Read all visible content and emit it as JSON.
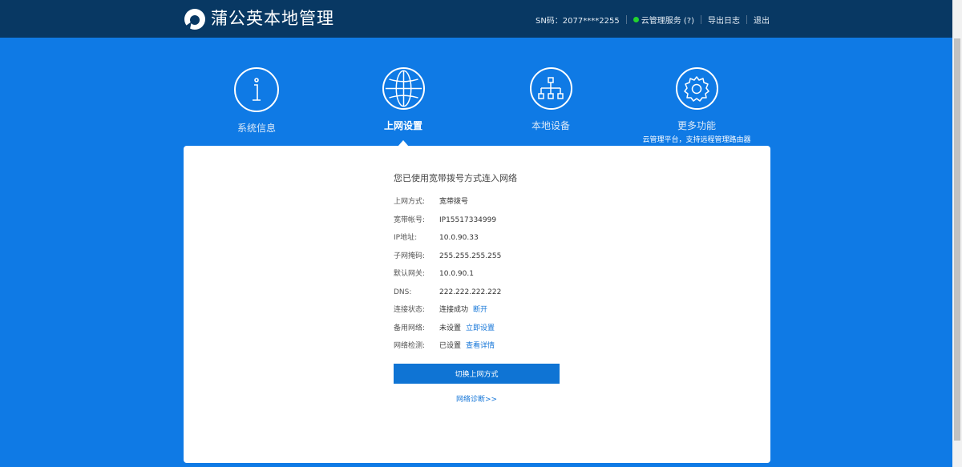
{
  "header": {
    "app_title": "蒲公英本地管理",
    "sn": "SN码：2077****2255",
    "cloud_service": "云管理服务 (?)",
    "export_log": "导出日志",
    "logout": "退出",
    "status_color": "#23d32e"
  },
  "nav": {
    "items": [
      {
        "label": "系统信息",
        "icon": "info-icon"
      },
      {
        "label": "上网设置",
        "icon": "globe-icon",
        "active": true
      },
      {
        "label": "本地设备",
        "icon": "network-tree-icon"
      },
      {
        "label": "更多功能",
        "icon": "gear-icon",
        "subtitle": "云管理平台，支持远程管理路由器"
      }
    ]
  },
  "main": {
    "title": "您已使用宽带拨号方式连入网络",
    "rows": [
      {
        "label": "上网方式:",
        "value": "宽带拨号"
      },
      {
        "label": "宽带帐号:",
        "value": "IP15517334999"
      },
      {
        "label": "IP地址:",
        "value": "10.0.90.33"
      },
      {
        "label": "子网掩码:",
        "value": "255.255.255.255"
      },
      {
        "label": "默认网关:",
        "value": "10.0.90.1"
      },
      {
        "label": "DNS:",
        "value": "222.222.222.222"
      },
      {
        "label": "连接状态:",
        "value": "连接成功",
        "link": "断开"
      },
      {
        "label": "备用网络:",
        "value": "未设置",
        "link": "立即设置"
      },
      {
        "label": "网络检测:",
        "value": "已设置",
        "link": "查看详情"
      }
    ],
    "switch_button": "切换上网方式",
    "diagnose_link": "网络诊断>>"
  },
  "colors": {
    "background": "#0f7ae5",
    "header": "#083863",
    "accent": "#0f74d4",
    "link": "#1576d8"
  }
}
